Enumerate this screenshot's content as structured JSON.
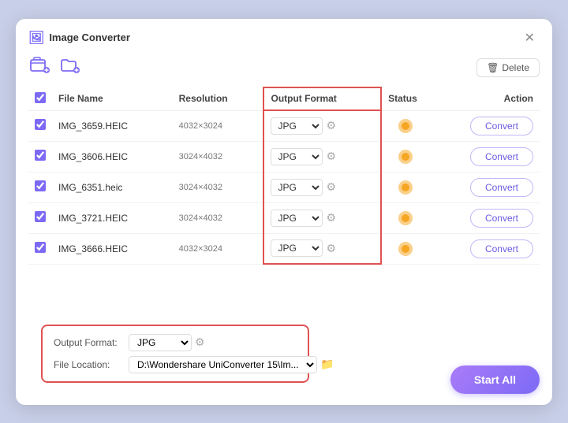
{
  "window": {
    "title": "Image Converter"
  },
  "toolbar": {
    "delete_label": "Delete"
  },
  "table": {
    "headers": {
      "checkbox": "",
      "filename": "File Name",
      "resolution": "Resolution",
      "output_format": "Output Format",
      "status": "Status",
      "action": "Action"
    },
    "rows": [
      {
        "id": 1,
        "checked": true,
        "filename": "IMG_3659.HEIC",
        "resolution": "4032×3024",
        "format": "JPG",
        "status": "pending"
      },
      {
        "id": 2,
        "checked": true,
        "filename": "IMG_3606.HEIC",
        "resolution": "3024×4032",
        "format": "JPG",
        "status": "pending"
      },
      {
        "id": 3,
        "checked": true,
        "filename": "IMG_6351.heic",
        "resolution": "3024×4032",
        "format": "JPG",
        "status": "pending"
      },
      {
        "id": 4,
        "checked": true,
        "filename": "IMG_3721.HEIC",
        "resolution": "3024×4032",
        "format": "JPG",
        "status": "pending"
      },
      {
        "id": 5,
        "checked": true,
        "filename": "IMG_3666.HEIC",
        "resolution": "4032×3024",
        "format": "JPG",
        "status": "pending"
      }
    ],
    "convert_label": "Convert"
  },
  "bottom_bar": {
    "output_format_label": "Output Format:",
    "output_format_value": "JPG",
    "file_location_label": "File Location:",
    "file_location_value": "D:\\Wondershare UniConverter 15\\Im..."
  },
  "footer": {
    "start_all_label": "Start All"
  }
}
